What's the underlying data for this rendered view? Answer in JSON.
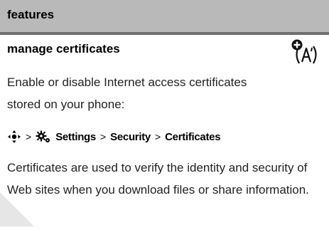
{
  "header": {
    "title": "features"
  },
  "section": {
    "title": "manage certificates",
    "icon": "network-feature-icon"
  },
  "intro": "Enable or disable Internet access certificates stored on your phone:",
  "menu_path": {
    "steps": [
      "Settings",
      "Security",
      "Certificates"
    ],
    "separator": ">",
    "icons": [
      "nav-key-icon",
      "settings-gear-icon"
    ]
  },
  "body": "Certificates are used to verify the identity and security of Web sites when you download files or share information.",
  "colors": {
    "header_bg": "#b9b9b9",
    "header_rule": "#6f6f6f",
    "text": "#222222",
    "page_curl": "#e6e6e6"
  }
}
